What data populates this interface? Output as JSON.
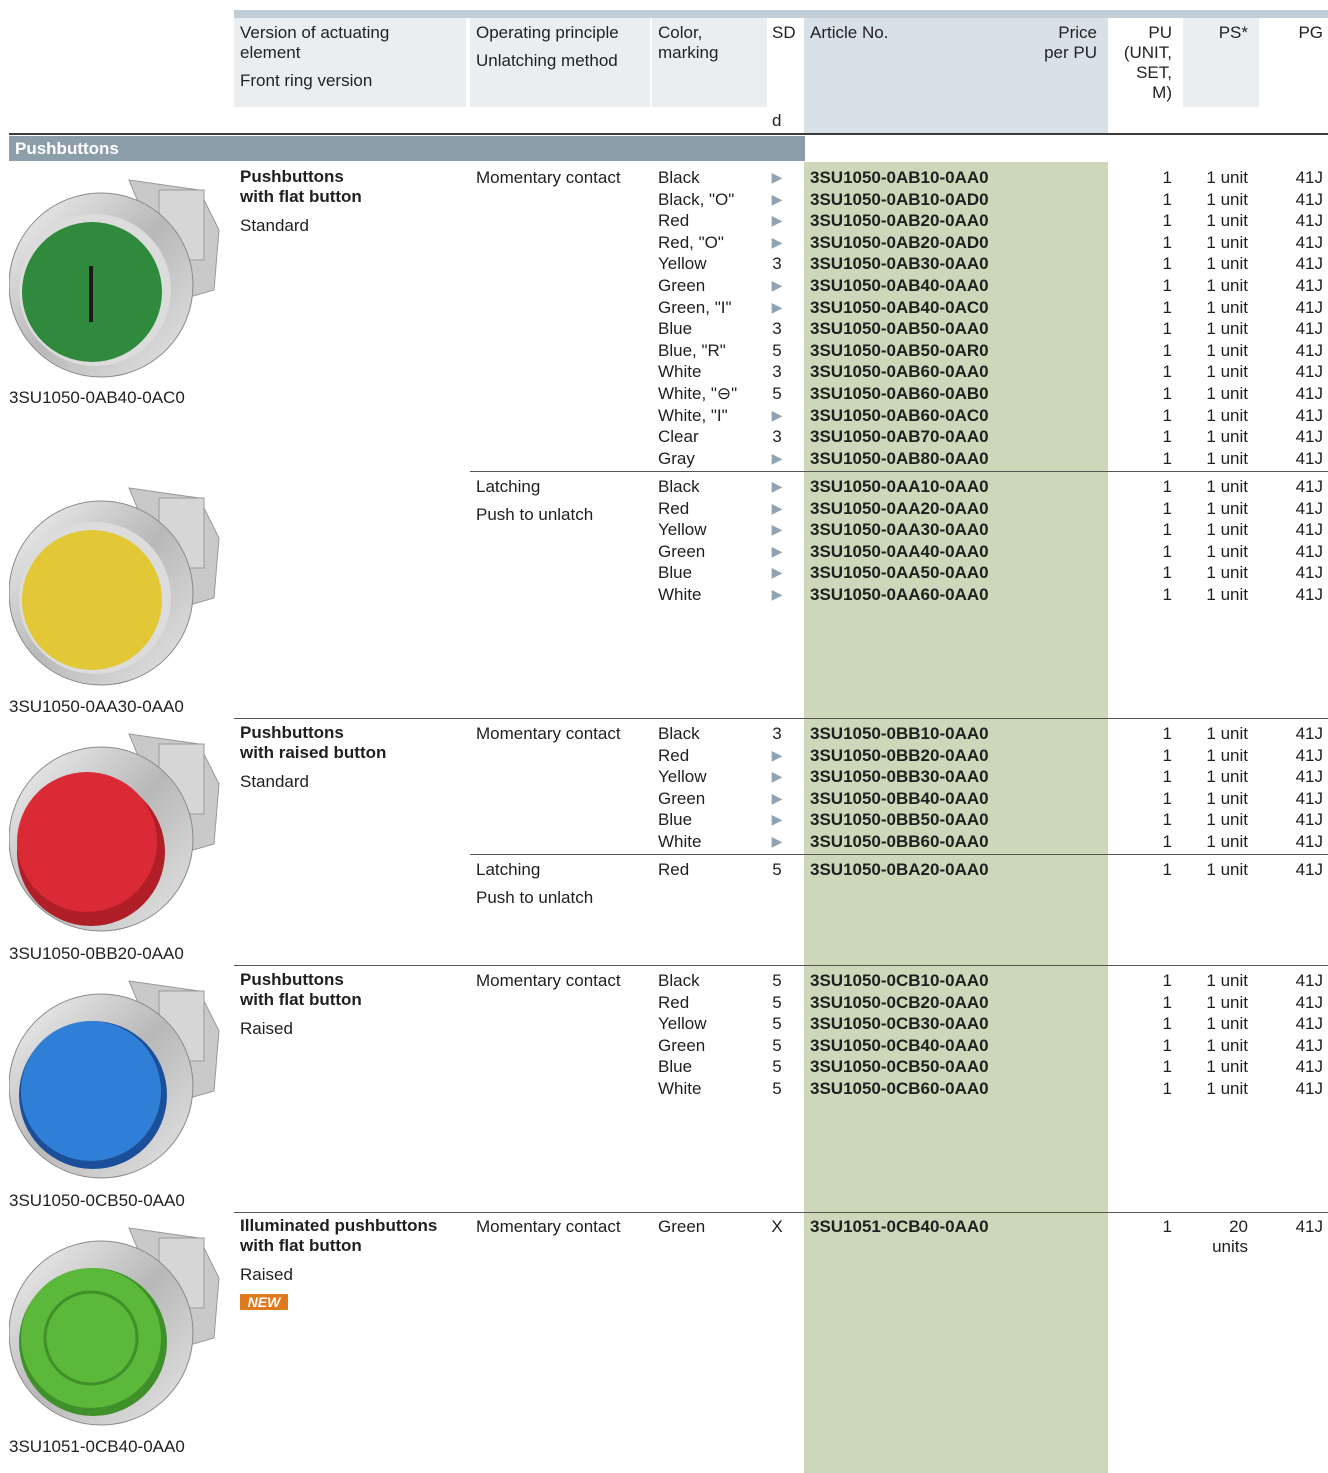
{
  "header": {
    "version_line1": "Version of actuating",
    "version_line2": "element",
    "version_line3": "Front ring version",
    "op_line1": "Operating principle",
    "op_line2": "Unlatching method",
    "color_line1": "Color,",
    "color_line2": "marking",
    "sd": "SD",
    "sd_sub": "d",
    "article": "Article No.",
    "price_line1": "Price",
    "price_line2": "per PU",
    "pu_line1": "PU",
    "pu_line2": "(UNIT,",
    "pu_line3": "SET,",
    "pu_line4": "M)",
    "ps": "PS*",
    "pg": "PG"
  },
  "section": "Pushbuttons",
  "groups": [
    {
      "title1": "Pushbuttons",
      "title2": "with flat button",
      "sub": "Standard",
      "caption": "3SU1050-0AB40-0AC0",
      "button_color": "#2f8a3e"
    },
    {
      "caption": "3SU1050-0AA30-0AA0",
      "button_color": "#e2c836"
    },
    {
      "title1": "Pushbuttons",
      "title2": "with raised button",
      "sub": "Standard",
      "caption": "3SU1050-0BB20-0AA0",
      "button_color": "#d92a35"
    },
    {
      "title1": "Pushbuttons",
      "title2": "with flat button",
      "sub": "Raised",
      "caption": "3SU1050-0CB50-0AA0",
      "button_color": "#2f7fd6"
    },
    {
      "title1": "Illuminated pushbuttons",
      "title2": "with flat button",
      "sub": "Raised",
      "badge": "NEW",
      "caption": "3SU1051-0CB40-0AA0",
      "button_color": "#5cb83a"
    }
  ],
  "ops": {
    "g1": "Momentary contact",
    "g2a": "Latching",
    "g2b": "Push to unlatch",
    "g3": "Momentary contact",
    "g4a": "Latching",
    "g4b": "Push to unlatch",
    "g5": "Momentary contact",
    "g6": "Momentary contact"
  },
  "rows": [
    {
      "color": "Black",
      "sd": "▶",
      "article": "3SU1050-0AB10-0AA0",
      "pu": "1",
      "ps": "1 unit",
      "pg": "41J"
    },
    {
      "color": "Black, \"O\"",
      "sd": "▶",
      "article": "3SU1050-0AB10-0AD0",
      "pu": "1",
      "ps": "1 unit",
      "pg": "41J"
    },
    {
      "color": "Red",
      "sd": "▶",
      "article": "3SU1050-0AB20-0AA0",
      "pu": "1",
      "ps": "1 unit",
      "pg": "41J"
    },
    {
      "color": "Red, \"O\"",
      "sd": "▶",
      "article": "3SU1050-0AB20-0AD0",
      "pu": "1",
      "ps": "1 unit",
      "pg": "41J"
    },
    {
      "color": "Yellow",
      "sd": "3",
      "article": "3SU1050-0AB30-0AA0",
      "pu": "1",
      "ps": "1 unit",
      "pg": "41J"
    },
    {
      "color": "Green",
      "sd": "▶",
      "article": "3SU1050-0AB40-0AA0",
      "pu": "1",
      "ps": "1 unit",
      "pg": "41J"
    },
    {
      "color": "Green, \"I\"",
      "sd": "▶",
      "article": "3SU1050-0AB40-0AC0",
      "pu": "1",
      "ps": "1 unit",
      "pg": "41J"
    },
    {
      "color": "Blue",
      "sd": "3",
      "article": "3SU1050-0AB50-0AA0",
      "pu": "1",
      "ps": "1 unit",
      "pg": "41J"
    },
    {
      "color": "Blue, \"R\"",
      "sd": "5",
      "article": "3SU1050-0AB50-0AR0",
      "pu": "1",
      "ps": "1 unit",
      "pg": "41J"
    },
    {
      "color": "White",
      "sd": "3",
      "article": "3SU1050-0AB60-0AA0",
      "pu": "1",
      "ps": "1 unit",
      "pg": "41J"
    },
    {
      "color": "White, \"⊖\"",
      "sd": "5",
      "article": "3SU1050-0AB60-0AB0",
      "pu": "1",
      "ps": "1 unit",
      "pg": "41J"
    },
    {
      "color": "White, \"I\"",
      "sd": "▶",
      "article": "3SU1050-0AB60-0AC0",
      "pu": "1",
      "ps": "1 unit",
      "pg": "41J"
    },
    {
      "color": "Clear",
      "sd": "3",
      "article": "3SU1050-0AB70-0AA0",
      "pu": "1",
      "ps": "1 unit",
      "pg": "41J"
    },
    {
      "color": "Gray",
      "sd": "▶",
      "article": "3SU1050-0AB80-0AA0",
      "pu": "1",
      "ps": "1 unit",
      "pg": "41J"
    },
    {
      "color": "Black",
      "sd": "▶",
      "article": "3SU1050-0AA10-0AA0",
      "pu": "1",
      "ps": "1 unit",
      "pg": "41J"
    },
    {
      "color": "Red",
      "sd": "▶",
      "article": "3SU1050-0AA20-0AA0",
      "pu": "1",
      "ps": "1 unit",
      "pg": "41J"
    },
    {
      "color": "Yellow",
      "sd": "▶",
      "article": "3SU1050-0AA30-0AA0",
      "pu": "1",
      "ps": "1 unit",
      "pg": "41J"
    },
    {
      "color": "Green",
      "sd": "▶",
      "article": "3SU1050-0AA40-0AA0",
      "pu": "1",
      "ps": "1 unit",
      "pg": "41J"
    },
    {
      "color": "Blue",
      "sd": "▶",
      "article": "3SU1050-0AA50-0AA0",
      "pu": "1",
      "ps": "1 unit",
      "pg": "41J"
    },
    {
      "color": "White",
      "sd": "▶",
      "article": "3SU1050-0AA60-0AA0",
      "pu": "1",
      "ps": "1 unit",
      "pg": "41J"
    },
    {
      "color": "Black",
      "sd": "3",
      "article": "3SU1050-0BB10-0AA0",
      "pu": "1",
      "ps": "1 unit",
      "pg": "41J"
    },
    {
      "color": "Red",
      "sd": "▶",
      "article": "3SU1050-0BB20-0AA0",
      "pu": "1",
      "ps": "1 unit",
      "pg": "41J"
    },
    {
      "color": "Yellow",
      "sd": "▶",
      "article": "3SU1050-0BB30-0AA0",
      "pu": "1",
      "ps": "1 unit",
      "pg": "41J"
    },
    {
      "color": "Green",
      "sd": "▶",
      "article": "3SU1050-0BB40-0AA0",
      "pu": "1",
      "ps": "1 unit",
      "pg": "41J"
    },
    {
      "color": "Blue",
      "sd": "▶",
      "article": "3SU1050-0BB50-0AA0",
      "pu": "1",
      "ps": "1 unit",
      "pg": "41J"
    },
    {
      "color": "White",
      "sd": "▶",
      "article": "3SU1050-0BB60-0AA0",
      "pu": "1",
      "ps": "1 unit",
      "pg": "41J"
    },
    {
      "color": "Red",
      "sd": "5",
      "article": "3SU1050-0BA20-0AA0",
      "pu": "1",
      "ps": "1 unit",
      "pg": "41J"
    },
    {
      "color": "Black",
      "sd": "5",
      "article": "3SU1050-0CB10-0AA0",
      "pu": "1",
      "ps": "1 unit",
      "pg": "41J"
    },
    {
      "color": "Red",
      "sd": "5",
      "article": "3SU1050-0CB20-0AA0",
      "pu": "1",
      "ps": "1 unit",
      "pg": "41J"
    },
    {
      "color": "Yellow",
      "sd": "5",
      "article": "3SU1050-0CB30-0AA0",
      "pu": "1",
      "ps": "1 unit",
      "pg": "41J"
    },
    {
      "color": "Green",
      "sd": "5",
      "article": "3SU1050-0CB40-0AA0",
      "pu": "1",
      "ps": "1 unit",
      "pg": "41J"
    },
    {
      "color": "Blue",
      "sd": "5",
      "article": "3SU1050-0CB50-0AA0",
      "pu": "1",
      "ps": "1 unit",
      "pg": "41J"
    },
    {
      "color": "White",
      "sd": "5",
      "article": "3SU1050-0CB60-0AA0",
      "pu": "1",
      "ps": "1 unit",
      "pg": "41J"
    },
    {
      "color": "Green",
      "sd": "X",
      "article": "3SU1051-0CB40-0AA0",
      "pu": "1",
      "ps": "20",
      "ps2": "units",
      "pg": "41J"
    }
  ]
}
